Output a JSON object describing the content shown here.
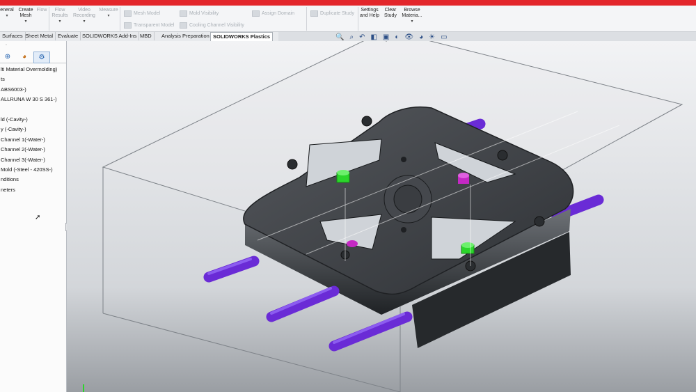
{
  "ribbon": {
    "general_label": "eneral",
    "create_mesh_label": "Create Mesh",
    "flow_label": "Flow",
    "flow_results_label": "Flow Results",
    "video_recording_label": "Video Recording",
    "measure_label": "Measure",
    "mesh_model_label": "Mesh Model",
    "transparent_model_label": "Transparent Model",
    "mold_visibility_label": "Mold Visibility",
    "cooling_channel_visibility_label": "Cooling Channel Visibility",
    "assign_domain_label": "Assign Domain",
    "duplicate_study_label": "Duplicate Study",
    "settings_help_label": "Settings and Help",
    "clear_study_label": "Clear Study",
    "browse_material_label": "Browse Materia..."
  },
  "tabs": [
    "Surfaces",
    "Sheet Metal",
    "Evaluate",
    "SOLIDWORKS Add-Ins",
    "MBD",
    "Analysis Preparation",
    "SOLIDWORKS Plastics"
  ],
  "active_tab": "SOLIDWORKS Plastics",
  "tree": {
    "items": [
      "lti Material Overmolding)",
      "ts",
      "ABS6003-)",
      "ALLRUNA W 30 S 361-)",
      "",
      "ld (-Cavity-)",
      "y (-Cavity-)",
      "Channel 1(-Water-)",
      "Channel 2(-Water-)",
      "Channel 3(-Water-)",
      "Mold (-Steel - 420SS-)",
      "nditions",
      "neters"
    ]
  },
  "colors": {
    "accent_red": "#e3262b",
    "part_gray": "#3a3d42",
    "channel_purple": "#6a2bd6",
    "gate_green": "#2bd62b",
    "gate_magenta": "#c428c4"
  }
}
